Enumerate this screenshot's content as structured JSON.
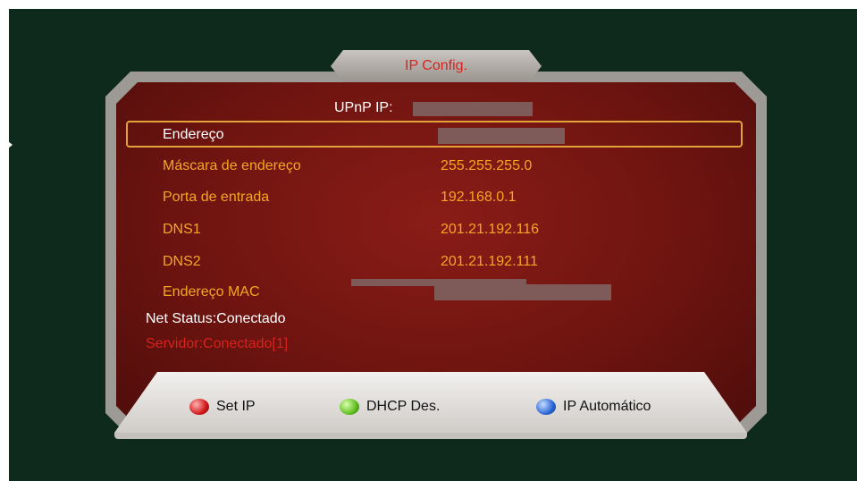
{
  "title": "IP Config.",
  "upnp_label": "UPnP IP:",
  "rows": [
    {
      "label": "Endereço",
      "value": ""
    },
    {
      "label": "Máscara de endereço",
      "value": "255.255.255.0"
    },
    {
      "label": "Porta de entrada",
      "value": "192.168.0.1"
    },
    {
      "label": "DNS1",
      "value": "201.21.192.116"
    },
    {
      "label": "DNS2",
      "value": "201.21.192.111"
    },
    {
      "label": "Endereço MAC",
      "value": ""
    }
  ],
  "net_status": "Net Status:Conectado",
  "server_status": "Servidor:Conectado[1]",
  "buttons": {
    "set_ip": "Set IP",
    "dhcp": "DHCP Des.",
    "auto_ip": "IP Automático"
  },
  "colors": {
    "accent_orange": "#f5a623",
    "server_red": "#d8221e",
    "panel_red": "#7a1611",
    "background": "#0d2a1c"
  }
}
